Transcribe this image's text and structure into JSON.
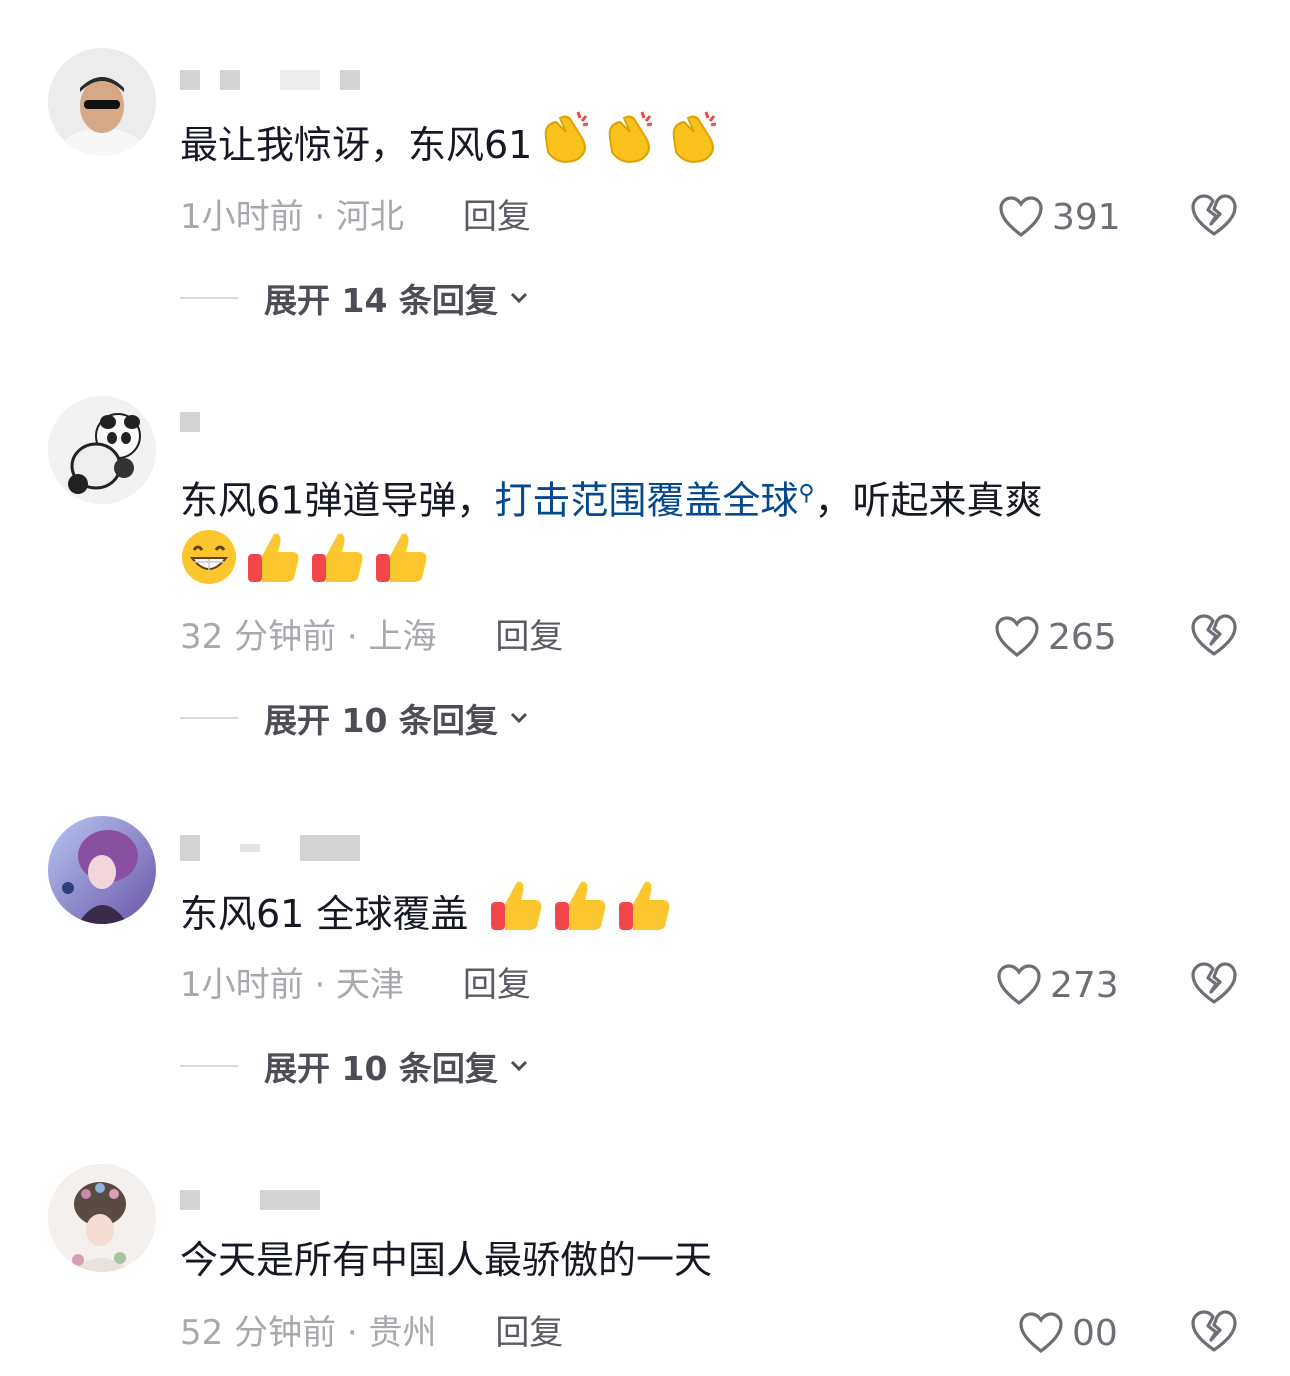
{
  "comments": [
    {
      "text": "最让我惊讶，东风61",
      "emojis": [
        "clap-emoji",
        "clap-emoji",
        "clap-emoji"
      ],
      "time_location": "1小时前 · 河北",
      "reply_label": "回复",
      "likes": "391",
      "expand_label": "展开 14 条回复"
    },
    {
      "text_before": "东风61弹道导弹，",
      "link_text": "打击范围覆盖全球",
      "link_icon": "search-icon",
      "text_after": "，听起来真爽",
      "emojis": [
        "grin-emoji",
        "thumbs-up-emoji",
        "thumbs-up-emoji",
        "thumbs-up-emoji"
      ],
      "time_location": "32 分钟前 · 上海",
      "reply_label": "回复",
      "likes": "265",
      "expand_label": "展开 10 条回复"
    },
    {
      "text": "东风61 全球覆盖 ",
      "emojis": [
        "thumbs-up-emoji",
        "thumbs-up-emoji",
        "thumbs-up-emoji"
      ],
      "time_location": "1小时前 · 天津",
      "reply_label": "回复",
      "likes": "273",
      "expand_label": "展开 10 条回复"
    },
    {
      "text": "今天是所有中国人最骄傲的一天",
      "time_location": "52 分钟前 · 贵州",
      "reply_label": "回复",
      "likes": "00"
    }
  ],
  "colors": {
    "text": "#161823",
    "meta": "#a8a9ae",
    "link": "#04498d",
    "icon": "#6e6f76"
  }
}
